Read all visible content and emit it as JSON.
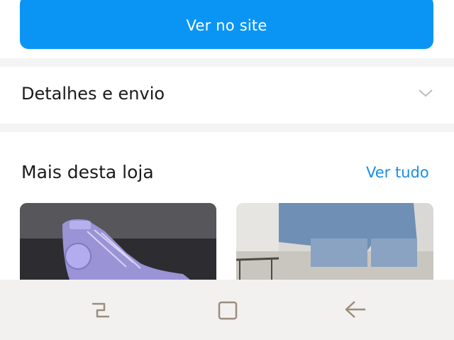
{
  "primary_action": {
    "label": "Ver no site",
    "color": "#0a95f5"
  },
  "details": {
    "title": "Detalhes e envio",
    "chevron_icon": "chevron-down-icon"
  },
  "more_from_store": {
    "title": "Mais desta loja",
    "see_all_label": "Ver tudo",
    "see_all_color": "#1a8ee6",
    "products": [
      {
        "image": "purple-high-top-sneaker"
      },
      {
        "image": "cuffed-denim-jeans"
      }
    ]
  },
  "system_nav": {
    "buttons": [
      "recent-apps-icon",
      "home-icon",
      "back-icon"
    ]
  }
}
